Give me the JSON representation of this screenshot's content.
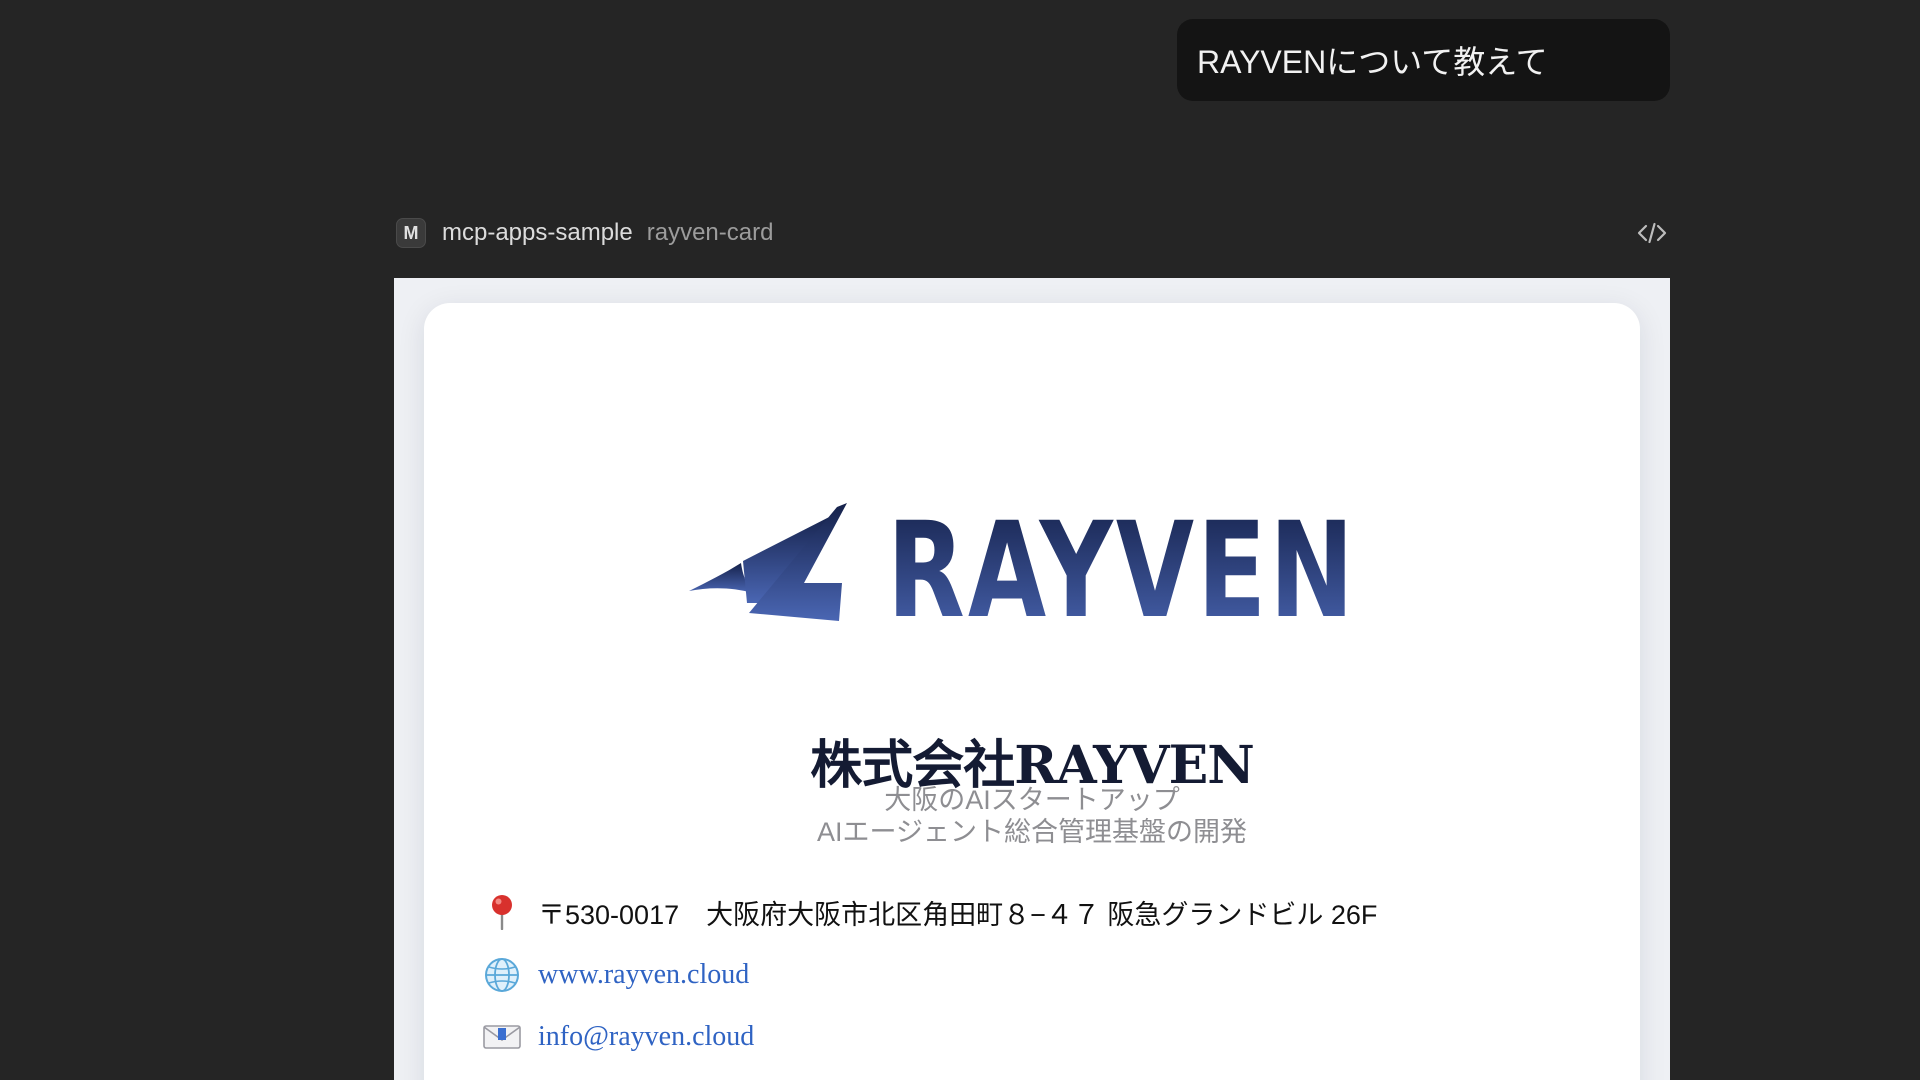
{
  "chat": {
    "user_message": "RAYVENについて教えて"
  },
  "tool": {
    "badge": "M",
    "server": "mcp-apps-sample",
    "name": "rayven-card",
    "code_toggle_icon": "code-brackets-icon"
  },
  "card": {
    "logo_text": "RAYVEN",
    "company_name": "株式会社RAYVEN",
    "tagline_line1": "大阪のAIスタートアップ",
    "tagline_line2": "AIエージェント総合管理基盤の開発",
    "address": "〒530-0017　大阪府大阪市北区角田町８−４７ 阪急グランドビル 26F",
    "website": "www.rayven.cloud",
    "email": "info@rayven.cloud",
    "icons": {
      "address": "pin-icon",
      "website": "globe-icon",
      "email": "envelope-icon"
    }
  },
  "colors": {
    "background": "#252525",
    "bubble": "#141414",
    "logo_navy": "#15214a",
    "logo_blue": "#4a66b3",
    "link": "#2f63c3"
  }
}
